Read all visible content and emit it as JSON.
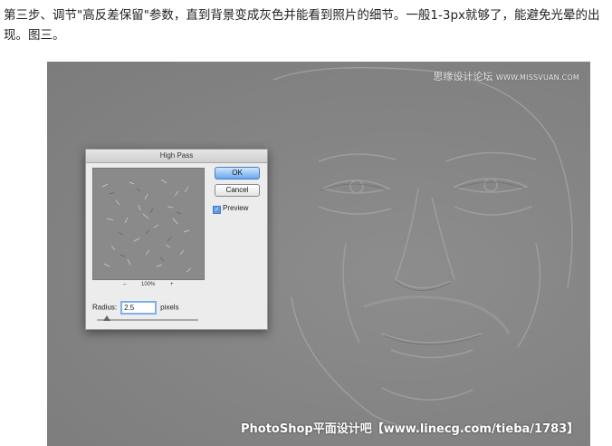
{
  "caption": "第三步、调节\"高反差保留\"参数，直到背景变成灰色并能看到照片的细节。一般1-3px就够了，能避免光晕的出现。图三。",
  "watermark_top": {
    "cn": "思缘设计论坛",
    "en": "WWW.MISSVUAN.COM"
  },
  "watermark_bottom": "PhotoShop平面设计吧【www.linecg.com/tieba/1783】",
  "dialog": {
    "title": "High Pass",
    "ok_label": "OK",
    "cancel_label": "Cancel",
    "preview_label": "Preview",
    "preview_checked": true,
    "zoom_minus": "–",
    "zoom_level": "100%",
    "zoom_plus": "+",
    "radius_label": "Radius:",
    "radius_value": "2.5",
    "radius_unit": "pixels",
    "radius_slider_fraction": 0.1
  },
  "colors": {
    "photo_gray": "#858585",
    "ok_blue": "#6aa8ee"
  }
}
